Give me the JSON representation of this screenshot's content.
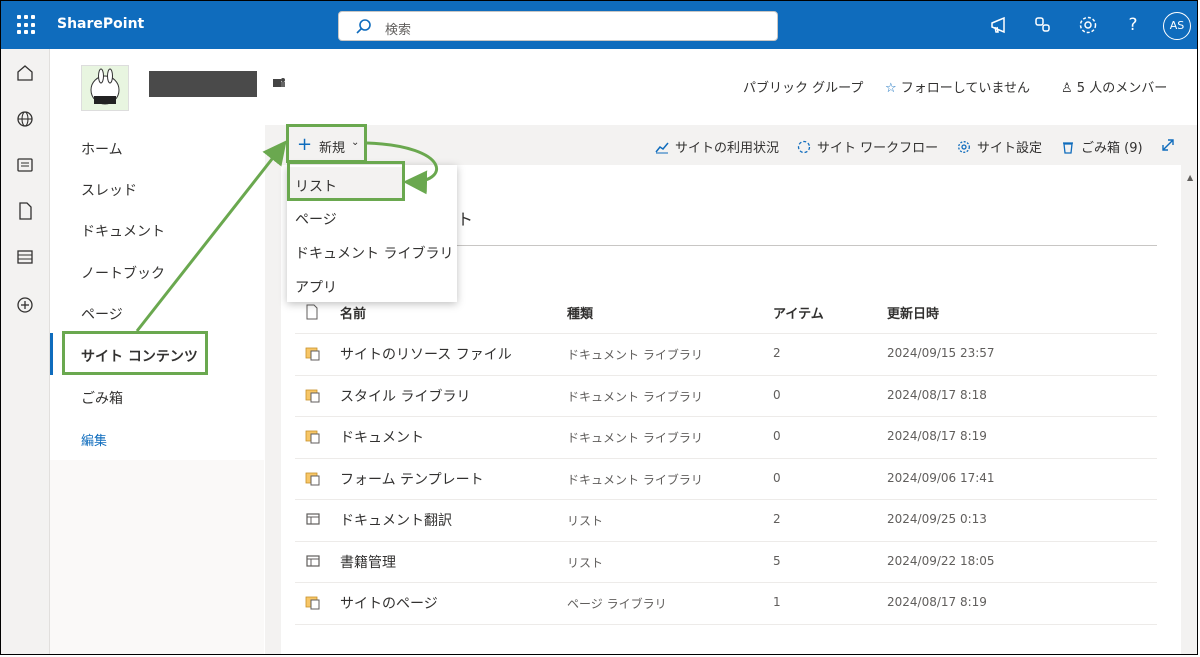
{
  "suite": {
    "brand": "SharePoint",
    "search_placeholder": "検索",
    "avatar_initials": "AS",
    "icons": [
      "megaphone-icon",
      "share-icon",
      "gear-icon",
      "help-icon"
    ]
  },
  "rail": {
    "icons": [
      "home-icon",
      "globe-icon",
      "news-icon",
      "file-icon",
      "list-icon",
      "add-icon"
    ]
  },
  "site": {
    "group_type": "パブリック グループ",
    "follow": "フォローしていません",
    "members": "5 人のメンバー"
  },
  "nav": {
    "items": [
      "ホーム",
      "スレッド",
      "ドキュメント",
      "ノートブック",
      "ページ",
      "サイト コンテンツ",
      "ごみ箱"
    ],
    "active": "サイト コンテンツ",
    "edit": "編集"
  },
  "commands": {
    "new": "新規",
    "usage": "サイトの利用状況",
    "workflow": "サイト ワークフロー",
    "settings": "サイト設定",
    "recycle": "ごみ箱 (9)"
  },
  "new_menu": {
    "items": [
      "リスト",
      "ページ",
      "ドキュメント ライブラリ",
      "アプリ"
    ],
    "highlighted": "リスト"
  },
  "peek_text": "ト",
  "table": {
    "headers": {
      "name": "名前",
      "type": "種類",
      "items": "アイテム",
      "modified": "更新日時"
    },
    "rows": [
      {
        "icon": "library-icon",
        "name": "サイトのリソース ファイル",
        "type": "ドキュメント ライブラリ",
        "items": "2",
        "modified": "2024/09/15 23:57"
      },
      {
        "icon": "library-icon",
        "name": "スタイル ライブラリ",
        "type": "ドキュメント ライブラリ",
        "items": "0",
        "modified": "2024/08/17 8:18"
      },
      {
        "icon": "library-icon",
        "name": "ドキュメント",
        "type": "ドキュメント ライブラリ",
        "items": "0",
        "modified": "2024/08/17 8:19"
      },
      {
        "icon": "library-icon",
        "name": "フォーム テンプレート",
        "type": "ドキュメント ライブラリ",
        "items": "0",
        "modified": "2024/09/06 17:41"
      },
      {
        "icon": "list-icon",
        "name": "ドキュメント翻訳",
        "type": "リスト",
        "items": "2",
        "modified": "2024/09/25 0:13"
      },
      {
        "icon": "list-icon",
        "name": "書籍管理",
        "type": "リスト",
        "items": "5",
        "modified": "2024/09/22 18:05"
      },
      {
        "icon": "library-icon",
        "name": "サイトのページ",
        "type": "ページ ライブラリ",
        "items": "1",
        "modified": "2024/08/17 8:19"
      }
    ]
  },
  "colors": {
    "suitebar": "#0f6cbd",
    "annotation": "#6aa84f"
  }
}
